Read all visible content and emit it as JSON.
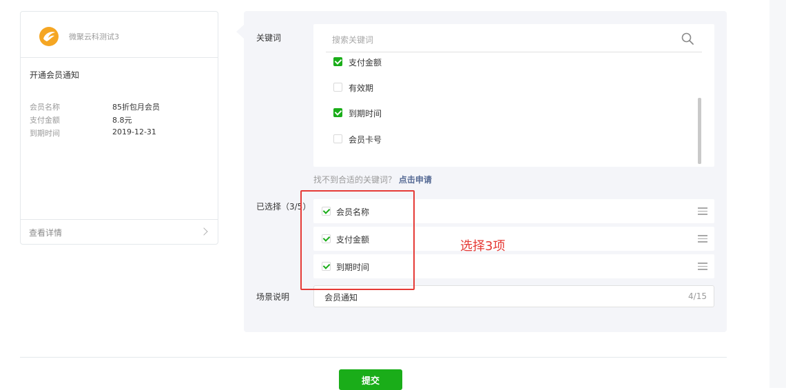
{
  "preview": {
    "account_name": "微聚云科测试3",
    "notice_title": "开通会员通知",
    "fields": [
      {
        "key": "会员名称",
        "value": "85折包月会员"
      },
      {
        "key": "支付金额",
        "value": "8.8元"
      },
      {
        "key": "到期时间",
        "value": "2019-12-31"
      }
    ],
    "details_link": "查看详情"
  },
  "form": {
    "keyword_label": "关键词",
    "search_placeholder": "搜索关键词",
    "keywords": [
      {
        "label": "支付金额",
        "checked": true
      },
      {
        "label": "有效期",
        "checked": false
      },
      {
        "label": "到期时间",
        "checked": true
      },
      {
        "label": "会员卡号",
        "checked": false
      }
    ],
    "hint_text": "找不到合适的关键词？",
    "hint_link": "点击申请",
    "selected_label": "已选择（3/5）",
    "selected": [
      "会员名称",
      "支付金额",
      "到期时间"
    ],
    "scene_label": "场景说明",
    "scene_value": "会员通知",
    "scene_count": "4/15"
  },
  "annotation": "选择3项",
  "submit_label": "提交",
  "colors": {
    "primary": "#1aad19",
    "annotation": "#e53935",
    "link": "#576b95"
  }
}
